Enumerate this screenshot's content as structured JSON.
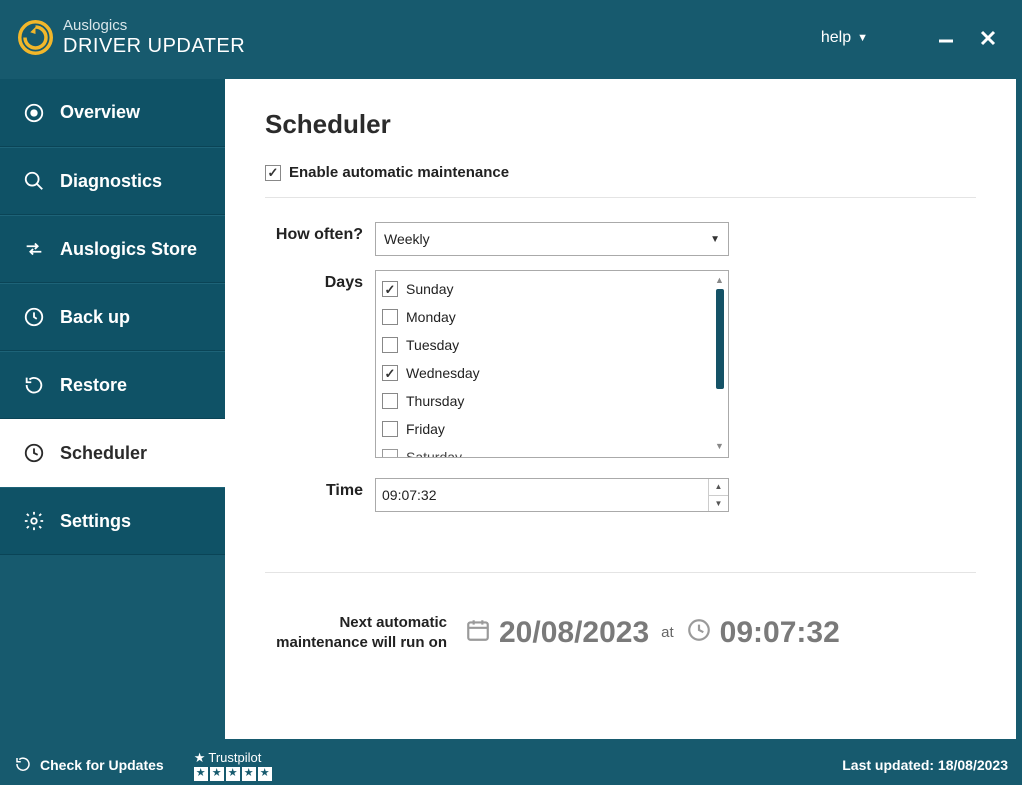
{
  "app": {
    "brand_top": "Auslogics",
    "brand_bottom": "DRIVER UPDATER"
  },
  "titlebar": {
    "help_label": "help"
  },
  "sidebar": {
    "items": [
      {
        "label": "Overview"
      },
      {
        "label": "Diagnostics"
      },
      {
        "label": "Auslogics Store"
      },
      {
        "label": "Back up"
      },
      {
        "label": "Restore"
      },
      {
        "label": "Scheduler"
      },
      {
        "label": "Settings"
      }
    ]
  },
  "page": {
    "title": "Scheduler",
    "enable_label": "Enable automatic maintenance",
    "enable_checked": true,
    "how_often_label": "How often?",
    "how_often_value": "Weekly",
    "days_label": "Days",
    "days": [
      {
        "label": "Sunday",
        "checked": true
      },
      {
        "label": "Monday",
        "checked": false
      },
      {
        "label": "Tuesday",
        "checked": false
      },
      {
        "label": "Wednesday",
        "checked": true
      },
      {
        "label": "Thursday",
        "checked": false
      },
      {
        "label": "Friday",
        "checked": false
      },
      {
        "label": "Saturday",
        "checked": false
      }
    ],
    "time_label": "Time",
    "time_value": "09:07:32",
    "next_label_line1": "Next automatic",
    "next_label_line2": "maintenance will run on",
    "next_date": "20/08/2023",
    "next_at": "at",
    "next_time": "09:07:32"
  },
  "statusbar": {
    "check_updates": "Check for Updates",
    "trustpilot": "Trustpilot",
    "last_updated": "Last updated: 18/08/2023"
  }
}
